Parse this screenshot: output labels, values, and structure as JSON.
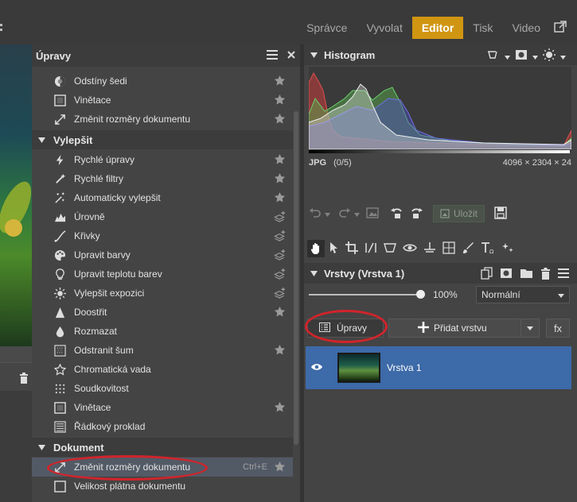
{
  "tabs": [
    {
      "label": "Správce",
      "active": false
    },
    {
      "label": "Vyvolat",
      "active": false
    },
    {
      "label": "Editor",
      "active": true
    },
    {
      "label": "Tisk",
      "active": false
    },
    {
      "label": "Video",
      "active": false
    }
  ],
  "adjustments": {
    "title": "Úpravy",
    "top_items": [
      {
        "label": "Odstíny šedi",
        "icon": "grayscale-icon",
        "star": "star"
      },
      {
        "label": "Vinětace",
        "icon": "vignette-icon",
        "star": "star"
      },
      {
        "label": "Změnit rozměry dokumentu",
        "icon": "resize-icon",
        "star": "star"
      }
    ],
    "section_enhance": "Vylepšit",
    "enhance_items": [
      {
        "label": "Rychlé úpravy",
        "icon": "lightning-icon",
        "star": "star"
      },
      {
        "label": "Rychlé filtry",
        "icon": "filter-icon",
        "star": "star"
      },
      {
        "label": "Automaticky vylepšit",
        "icon": "magic-wand-icon",
        "star": "star"
      },
      {
        "label": "Úrovně",
        "icon": "levels-icon",
        "star": "layer-plus"
      },
      {
        "label": "Křivky",
        "icon": "curves-icon",
        "star": "layer-plus"
      },
      {
        "label": "Upravit barvy",
        "icon": "palette-icon",
        "star": "layer-plus"
      },
      {
        "label": "Upravit teplotu barev",
        "icon": "bulb-icon",
        "star": "layer-plus"
      },
      {
        "label": "Vylepšit expozici",
        "icon": "exposure-icon",
        "star": "layer-plus"
      },
      {
        "label": "Doostřit",
        "icon": "sharpen-icon",
        "star": "star"
      },
      {
        "label": "Rozmazat",
        "icon": "drop-icon",
        "star": "none"
      },
      {
        "label": "Odstranit šum",
        "icon": "noise-icon",
        "star": "star"
      },
      {
        "label": "Chromatická vada",
        "icon": "chromatic-icon",
        "star": "none"
      },
      {
        "label": "Soudkovitost",
        "icon": "distortion-icon",
        "star": "none"
      },
      {
        "label": "Vinětace",
        "icon": "vignette-icon",
        "star": "star"
      },
      {
        "label": "Řádkový proklad",
        "icon": "interlace-icon",
        "star": "none"
      }
    ],
    "section_document": "Dokument",
    "document_items": [
      {
        "label": "Změnit rozměry dokumentu",
        "icon": "resize-icon",
        "shortcut": "Ctrl+E",
        "star": "star"
      },
      {
        "label": "Velikost plátna dokumentu",
        "icon": "canvas-icon",
        "star": "none"
      }
    ]
  },
  "histogram": {
    "title": "Histogram",
    "format": "JPG",
    "count": "(0/5)",
    "dimensions": "4096 × 2304 × 24"
  },
  "toolbar": {
    "save_label": "Uložit"
  },
  "layers": {
    "title": "Vrstvy (Vrstva 1)",
    "opacity_label": "100%",
    "opacity": 1.0,
    "blend_mode": "Normální",
    "adjustments_button": "Úpravy",
    "add_layer_button": "Přidat vrstvu",
    "fx_label": "fx",
    "items": [
      {
        "name": "Vrstva 1",
        "visible": true,
        "selected": true
      }
    ]
  },
  "colors": {
    "accent": "#d09612",
    "selection": "#3d6aa8",
    "annotation": "#d1242b"
  }
}
